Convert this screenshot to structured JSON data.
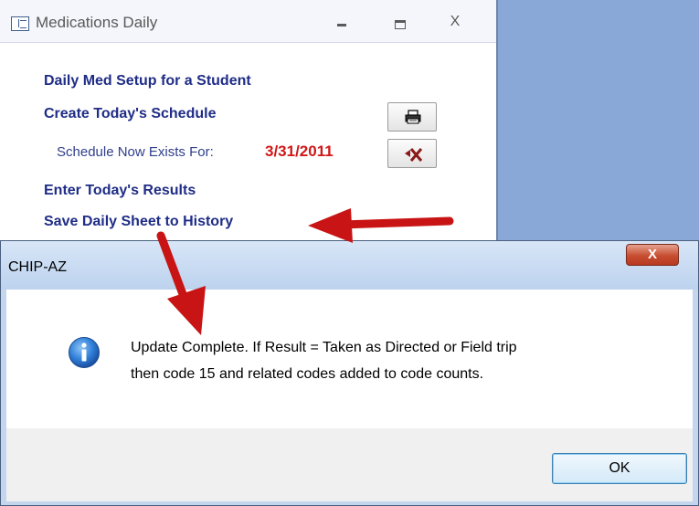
{
  "window": {
    "title": "Medications Daily",
    "close_glyph": "X"
  },
  "menu": {
    "setup_label": "Daily Med Setup for a Student",
    "create_schedule_label": "Create Today's Schedule",
    "enter_results_label": "Enter Today's Results",
    "save_history_label": "Save Daily Sheet to History"
  },
  "schedule": {
    "exists_label": "Schedule Now Exists For:",
    "date": "3/31/2011"
  },
  "dialog": {
    "title": "CHIP-AZ",
    "close_glyph": "X",
    "message_line1": "Update Complete. If Result = Taken as Directed or Field trip",
    "message_line2": "then code 15 and related codes added to code counts.",
    "ok_label": "OK"
  },
  "icons": {
    "form": "form-icon",
    "printer": "printer-icon",
    "delete": "delete-schedule-icon",
    "info": "info-icon"
  },
  "colors": {
    "menu_text": "#1f2d86",
    "date_text": "#d01818",
    "arrow": "#c81414"
  }
}
